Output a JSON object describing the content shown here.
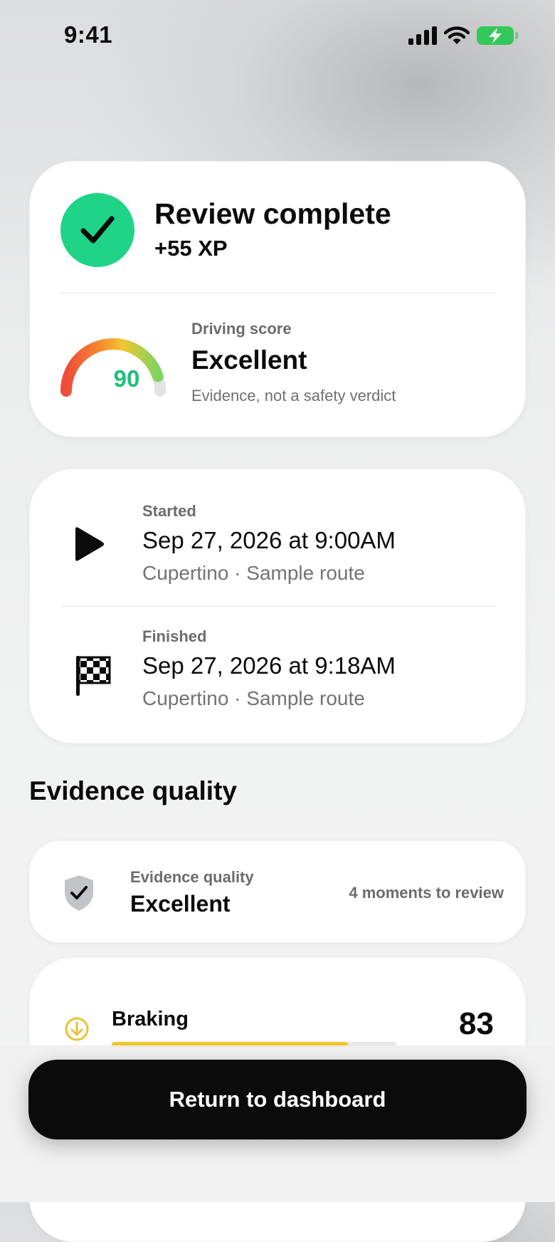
{
  "status_bar": {
    "time": "9:41"
  },
  "summary": {
    "title": "Review complete",
    "xp": "+55 XP",
    "score_label": "Driving score",
    "score_value": 90,
    "score_rating": "Excellent",
    "score_note": "Evidence, not a safety verdict"
  },
  "trip": {
    "start": {
      "label": "Started",
      "time": "Sep 27, 2026 at 9:00AM",
      "place": "Cupertino · Sample route",
      "icon": "play-icon"
    },
    "finish": {
      "label": "Finished",
      "time": "Sep 27, 2026 at 9:18AM",
      "place": "Cupertino · Sample route",
      "icon": "checkered-flag-icon"
    }
  },
  "evidence": {
    "section_title": "Evidence quality",
    "label": "Evidence quality",
    "value": "Excellent",
    "moments": "4 moments to review",
    "icon": "shield-check-icon"
  },
  "metrics": [
    {
      "label": "Braking",
      "score": 83,
      "progress": 0.83,
      "color": "#f2c531",
      "icon": "arrow-down-circle-icon"
    }
  ],
  "cta": {
    "label": "Return to dashboard"
  },
  "colors": {
    "accent_green": "#1fd387",
    "battery_green": "#34c759"
  }
}
